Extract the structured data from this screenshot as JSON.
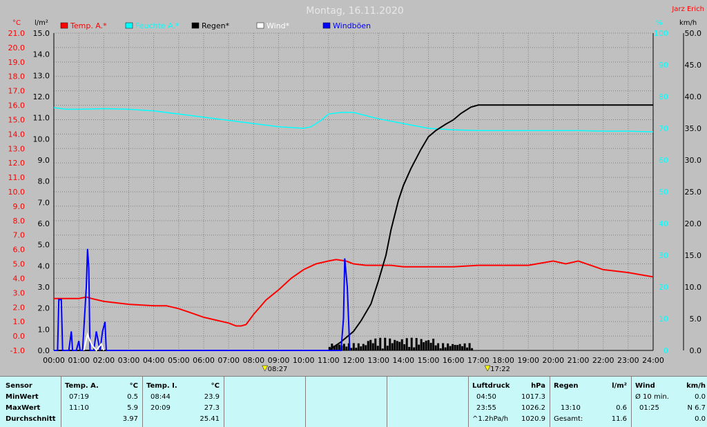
{
  "chart_data": {
    "type": "line",
    "title": "Montag, 16.11.2020",
    "author": "Jarz Erich",
    "unit_labels": {
      "temp": "°C",
      "rain": "l/m²",
      "hum": "%",
      "wind": "km/h"
    },
    "legend": [
      {
        "label": "Temp. A.*",
        "color": "#ff0000"
      },
      {
        "label": "Feuchte A.*",
        "color": "#00ffff"
      },
      {
        "label": "Regen*",
        "color": "#000000"
      },
      {
        "label": "Wind*",
        "color": "#ffffff"
      },
      {
        "label": "Windböen",
        "color": "#0000ff"
      }
    ],
    "x_ticks": [
      "00:00",
      "01:00",
      "02:00",
      "03:00",
      "04:00",
      "05:00",
      "06:00",
      "07:00",
      "08:00",
      "09:00",
      "10:00",
      "11:00",
      "12:00",
      "13:00",
      "14:00",
      "15:00",
      "16:00",
      "17:00",
      "18:00",
      "19:00",
      "20:00",
      "21:00",
      "22:00",
      "23:00",
      "24:00"
    ],
    "sunrise": "08:27",
    "sunset": "17:22",
    "temp_ticks": [
      "21.0",
      "20.0",
      "19.0",
      "18.0",
      "17.0",
      "16.0",
      "15.0",
      "14.0",
      "13.0",
      "12.0",
      "11.0",
      "10.0",
      "9.0",
      "8.0",
      "7.0",
      "6.0",
      "5.0",
      "4.0",
      "3.0",
      "2.0",
      "1.0",
      "0.0",
      "-1.0"
    ],
    "rain_ticks": [
      "15.0",
      "14.0",
      "13.0",
      "12.0",
      "11.0",
      "10.0",
      "9.0",
      "8.0",
      "7.0",
      "6.0",
      "5.0",
      "4.0",
      "3.0",
      "2.0",
      "1.0",
      "0.0"
    ],
    "hum_ticks": [
      "100",
      "90",
      "80",
      "70",
      "60",
      "50",
      "40",
      "30",
      "20",
      "10",
      "0"
    ],
    "wind_ticks": [
      "50.0",
      "45.0",
      "40.0",
      "35.0",
      "30.0",
      "25.0",
      "20.0",
      "15.0",
      "10.0",
      "5.0",
      "0.0"
    ],
    "temp_range": [
      -1,
      21
    ],
    "hum_range": [
      0,
      100
    ],
    "rain_range": [
      0,
      15
    ],
    "wind_range": [
      0,
      50
    ],
    "series": [
      {
        "name": "Temp. A.*",
        "axis": "temp",
        "color": "#ff0000",
        "x": [
          0,
          0.5,
          1,
          1.3,
          1.5,
          2,
          2.5,
          3,
          4,
          4.5,
          5,
          5.5,
          6,
          6.5,
          7,
          7.3,
          7.5,
          7.7,
          8,
          8.5,
          9,
          9.5,
          10,
          10.5,
          11,
          11.3,
          11.7,
          12,
          12.5,
          13,
          13.5,
          14,
          14.5,
          15,
          16,
          17,
          18,
          19,
          20,
          20.5,
          21,
          21.5,
          22,
          23,
          24
        ],
        "y": [
          2.6,
          2.6,
          2.6,
          2.7,
          2.6,
          2.4,
          2.3,
          2.2,
          2.1,
          2.1,
          1.9,
          1.6,
          1.3,
          1.1,
          0.9,
          0.7,
          0.7,
          0.8,
          1.5,
          2.5,
          3.2,
          4.0,
          4.6,
          5.0,
          5.2,
          5.3,
          5.2,
          5.0,
          4.9,
          4.9,
          4.9,
          4.8,
          4.8,
          4.8,
          4.8,
          4.9,
          4.9,
          4.9,
          5.2,
          5.0,
          5.2,
          4.9,
          4.6,
          4.4,
          4.1
        ]
      },
      {
        "name": "Feuchte A.*",
        "axis": "hum",
        "color": "#00ffff",
        "x": [
          0,
          0.5,
          1,
          2,
          3,
          4,
          5,
          6,
          7,
          8,
          9,
          10,
          10.3,
          10.7,
          11,
          11.5,
          12,
          12.5,
          13,
          14,
          15,
          16,
          17,
          18,
          19,
          20,
          21,
          22,
          23,
          24
        ],
        "y": [
          76.5,
          76,
          76,
          76.2,
          76,
          75.5,
          74.5,
          73.5,
          72.5,
          71.5,
          70.5,
          70,
          70.5,
          72.5,
          74.5,
          75,
          75,
          74,
          73,
          71.5,
          70,
          69.5,
          69.3,
          69.3,
          69.3,
          69.3,
          69.3,
          69.1,
          69.1,
          68.9
        ]
      },
      {
        "name": "Regen*",
        "axis": "rain",
        "color": "#000000",
        "x": [
          0,
          11,
          11.5,
          12,
          12.3,
          12.7,
          13,
          13.3,
          13.5,
          13.8,
          14,
          14.3,
          14.7,
          15,
          15.3,
          15.7,
          16,
          16.3,
          16.7,
          17,
          18,
          19,
          20,
          21,
          22,
          23,
          24
        ],
        "y": [
          0,
          0,
          0.4,
          0.9,
          1.4,
          2.2,
          3.3,
          4.5,
          5.7,
          7.1,
          7.8,
          8.6,
          9.5,
          10.1,
          10.4,
          10.7,
          10.9,
          11.2,
          11.5,
          11.6,
          11.6,
          11.6,
          11.6,
          11.6,
          11.6,
          11.6,
          11.6
        ]
      },
      {
        "name": "Windböen",
        "axis": "wind",
        "color": "#0000ff",
        "x": [
          0,
          0.15,
          0.2,
          0.3,
          0.35,
          0.6,
          0.7,
          0.75,
          0.9,
          1.0,
          1.05,
          1.15,
          1.3,
          1.35,
          1.4,
          1.45,
          1.55,
          1.6,
          1.7,
          1.8,
          1.85,
          1.95,
          2.05,
          2.1,
          2.15,
          11.5,
          11.6,
          11.65,
          11.75,
          11.85
        ],
        "y": [
          0,
          0,
          8,
          8,
          0,
          0,
          3,
          0,
          0,
          1.5,
          0,
          0,
          10,
          16,
          13,
          0,
          0,
          0,
          3,
          1,
          0,
          3,
          4.5,
          0,
          0,
          0,
          5,
          14.5,
          10,
          0
        ]
      },
      {
        "name": "Wind*",
        "axis": "wind",
        "color": "#ffffff",
        "x": [
          1.2,
          1.35,
          1.5,
          1.6,
          1.7,
          1.9,
          2.0
        ],
        "y": [
          0,
          2.5,
          1,
          0.5,
          0,
          1,
          0
        ]
      }
    ],
    "rain_bars": {
      "x_start": 11.0,
      "x_end": 16.8,
      "max": 0.6
    }
  },
  "table": {
    "sensor": {
      "header": "Sensor",
      "min": "MinWert",
      "max": "MaxWert",
      "avg": "Durchschnitt"
    },
    "temp_a": {
      "header": "Temp. A.",
      "unit": "°C",
      "min_time": "07:19",
      "min": "0.5",
      "max_time": "11:10",
      "max": "5.9",
      "avg": "3.97"
    },
    "temp_i": {
      "header": "Temp. I.",
      "unit": "°C",
      "min_time": "08:44",
      "min": "23.9",
      "max_time": "20:09",
      "max": "27.3",
      "avg": "25.41"
    },
    "pressure": {
      "header": "Luftdruck",
      "unit": "hPa",
      "min_time": "04:50",
      "min": "1017.3",
      "max_time": "23:55",
      "max": "1026.2",
      "trend": "^1.2hPa/h",
      "avg": "1020.9"
    },
    "rain": {
      "header": "Regen",
      "unit": "l/m²",
      "time": "13:10",
      "max": "0.6",
      "total_label": "Gesamt:",
      "total": "11.6"
    },
    "wind": {
      "header": "Wind",
      "unit": "km/h",
      "avg10_label": "Ø 10 min.",
      "avg10": "0.0",
      "max_time": "01:25",
      "max": "N 6.7",
      "avg": "0.0"
    }
  }
}
